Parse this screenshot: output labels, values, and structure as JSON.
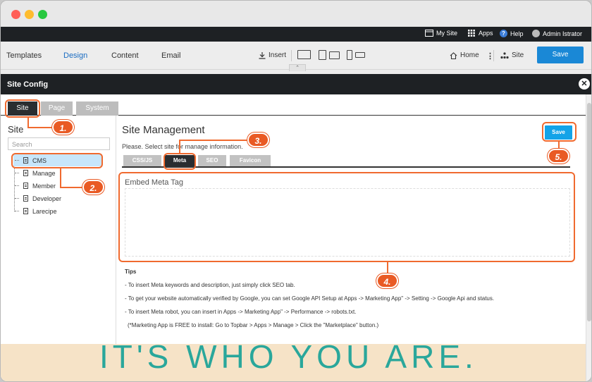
{
  "topbar": {
    "my_site": "My Site",
    "apps": "Apps",
    "help": "Help",
    "user": "Admin Istrator"
  },
  "toolbar": {
    "tabs": [
      "Templates",
      "Design",
      "Content",
      "Email"
    ],
    "active_tab": "Design",
    "insert": "Insert",
    "home": "Home",
    "site": "Site",
    "save": "Save"
  },
  "modal": {
    "title": "Site Config",
    "tabs": [
      "Site",
      "Page",
      "System"
    ]
  },
  "sidebar": {
    "title": "Site",
    "search_placeholder": "Search",
    "items": [
      "CMS",
      "Manage",
      "Member",
      "Developer",
      "Larecipe"
    ],
    "selected": "CMS"
  },
  "content": {
    "title": "Site Management",
    "subtitle": "Please. Select site for manage information.",
    "tabs": [
      "CSS/JS",
      "Meta",
      "SEO",
      "Favicon"
    ],
    "active_tab": "Meta",
    "save": "Save",
    "meta_label": "Embed Meta Tag"
  },
  "tips": {
    "title": "Tips",
    "lines": [
      "- To insert Meta keywords and description, just simply click SEO tab.",
      "- To get your website automatically verified by Google, you can set Google API Setup at Apps -> Marketing App\" -> Setting -> Google Api and status.",
      "- To insert Meta robot, you can insert in Apps -> Marketing App\" -> Performance -> robots.txt.",
      "  (*Marketing App is FREE to install: Go to Topbar > Apps > Manage > Click the \"Marketplace\" button.)"
    ]
  },
  "background_text": "IT'S WHO YOU ARE.",
  "callouts": [
    "1.",
    "2.",
    "3.",
    "4.",
    "5."
  ],
  "colors": {
    "accent": "#1a88d6",
    "callout": "#e95a24",
    "dark": "#1e2124"
  }
}
